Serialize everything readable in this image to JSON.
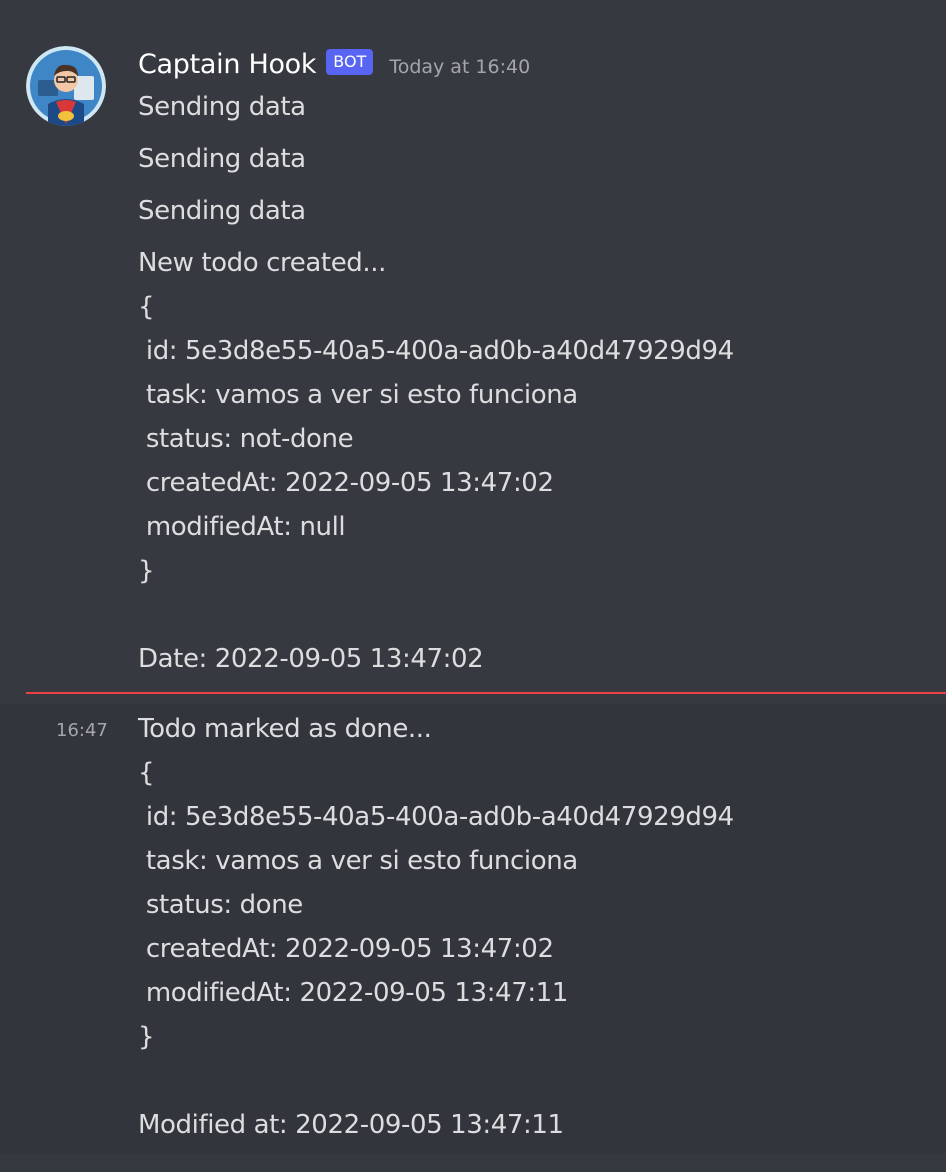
{
  "author": {
    "name": "Captain Hook",
    "tag": "BOT",
    "timestamp": "Today at 16:40",
    "avatar_icon": "superhero-developer-avatar"
  },
  "colors": {
    "background": "#36393f",
    "hover_background": "#32353b",
    "bot_tag": "#5865f2",
    "new_message_divider": "#ed4245"
  },
  "messages": [
    {
      "text": "Sending data"
    },
    {
      "text": "Sending data"
    },
    {
      "text": "Sending data"
    },
    {
      "lines": [
        "New todo created...",
        "{",
        " id: 5e3d8e55-40a5-400a-ad0b-a40d47929d94",
        " task: vamos a ver si esto funciona",
        " status: not-done",
        " createdAt: 2022-09-05 13:47:02",
        " modifiedAt: null",
        "}",
        "Date: 2022-09-05 13:47:02"
      ]
    },
    {
      "time": "16:47",
      "lines": [
        "Todo marked as done...",
        "{",
        " id: 5e3d8e55-40a5-400a-ad0b-a40d47929d94",
        " task: vamos a ver si esto funciona",
        " status: done",
        " createdAt: 2022-09-05 13:47:02",
        " modifiedAt: 2022-09-05 13:47:11",
        "}",
        "Modified at: 2022-09-05 13:47:11"
      ]
    }
  ]
}
